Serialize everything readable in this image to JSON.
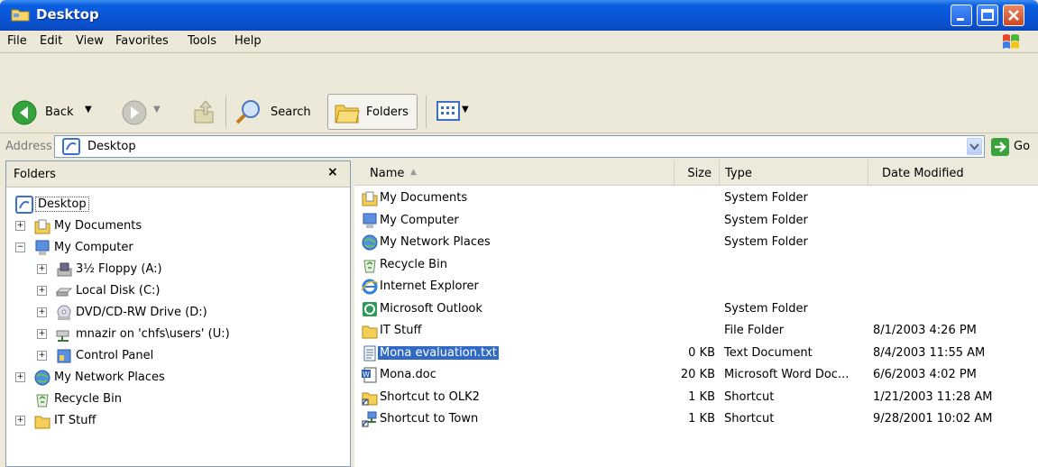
{
  "window": {
    "title": "Desktop",
    "title_icon": "folder-icon",
    "controls": {
      "minimize_icon": "minimize-icon",
      "maximize_icon": "maximize-icon",
      "close_icon": "close-icon"
    }
  },
  "menu": [
    "File",
    "Edit",
    "View",
    "Favorites",
    "Tools",
    "Help"
  ],
  "toolbar": {
    "back_label": "Back",
    "search_label": "Search",
    "folders_label": "Folders"
  },
  "address": {
    "label": "Address",
    "value": "Desktop",
    "go_label": "Go"
  },
  "folders_pane": {
    "title": "Folders",
    "close_glyph": "×",
    "tree": [
      {
        "label": "Desktop",
        "icon": "desktop-icon",
        "level": 0,
        "expander": ""
      },
      {
        "label": "My Documents",
        "icon": "my-documents-icon",
        "level": 1,
        "expander": "+"
      },
      {
        "label": "My Computer",
        "icon": "my-computer-icon",
        "level": 1,
        "expander": "−"
      },
      {
        "label": "3½ Floppy (A:)",
        "icon": "floppy-drive-icon",
        "level": 2,
        "expander": "+"
      },
      {
        "label": "Local Disk (C:)",
        "icon": "hard-disk-icon",
        "level": 2,
        "expander": "+"
      },
      {
        "label": "DVD/CD-RW Drive (D:)",
        "icon": "cd-drive-icon",
        "level": 2,
        "expander": "+"
      },
      {
        "label": "mnazir on 'chfs\\users' (U:)",
        "icon": "network-drive-icon",
        "level": 2,
        "expander": "+"
      },
      {
        "label": "Control Panel",
        "icon": "control-panel-icon",
        "level": 2,
        "expander": "+"
      },
      {
        "label": "My Network Places",
        "icon": "network-places-icon",
        "level": 1,
        "expander": "+"
      },
      {
        "label": "Recycle Bin",
        "icon": "recycle-bin-icon",
        "level": 1,
        "expander": ""
      },
      {
        "label": "IT Stuff",
        "icon": "folder-icon",
        "level": 1,
        "expander": "+"
      }
    ]
  },
  "file_list": {
    "columns": {
      "name": "Name",
      "size": "Size",
      "type": "Type",
      "date": "Date Modified"
    },
    "sort_indicator": "▲",
    "rows": [
      {
        "name": "My Documents",
        "size": "",
        "type": "System Folder",
        "date": "",
        "icon": "my-documents-icon"
      },
      {
        "name": "My Computer",
        "size": "",
        "type": "System Folder",
        "date": "",
        "icon": "my-computer-icon"
      },
      {
        "name": "My Network Places",
        "size": "",
        "type": "System Folder",
        "date": "",
        "icon": "network-places-icon"
      },
      {
        "name": "Recycle Bin",
        "size": "",
        "type": "",
        "date": "",
        "icon": "recycle-bin-icon"
      },
      {
        "name": "Internet Explorer",
        "size": "",
        "type": "",
        "date": "",
        "icon": "internet-explorer-icon"
      },
      {
        "name": "Microsoft Outlook",
        "size": "",
        "type": "System Folder",
        "date": "",
        "icon": "outlook-icon"
      },
      {
        "name": "IT Stuff",
        "size": "",
        "type": "File Folder",
        "date": "8/1/2003 4:26 PM",
        "icon": "folder-icon"
      },
      {
        "name": "Mona evaluation.txt",
        "size": "0 KB",
        "type": "Text Document",
        "date": "8/4/2003 11:55 AM",
        "icon": "text-file-icon",
        "selected": true
      },
      {
        "name": "Mona.doc",
        "size": "20 KB",
        "type": "Microsoft Word Doc...",
        "date": "6/6/2003 4:02 PM",
        "icon": "word-doc-icon"
      },
      {
        "name": "Shortcut to OLK2",
        "size": "1 KB",
        "type": "Shortcut",
        "date": "1/21/2003 11:28 AM",
        "icon": "shortcut-folder-icon"
      },
      {
        "name": "Shortcut to Town",
        "size": "1 KB",
        "type": "Shortcut",
        "date": "9/28/2001 10:02 AM",
        "icon": "shortcut-network-icon"
      }
    ]
  },
  "colors": {
    "titlebar": "#0a55d6",
    "selection": "#316ac5",
    "chrome": "#ece9d8"
  }
}
